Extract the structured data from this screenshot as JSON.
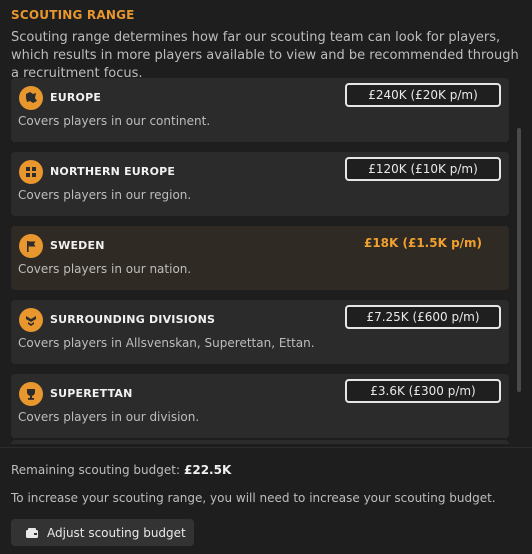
{
  "header": {
    "title": "SCOUTING RANGE",
    "description": "Scouting range determines how far our scouting team can look for players, which results in more players available to view and be recommended through a recruitment focus."
  },
  "ranges": [
    {
      "icon": "continent-icon",
      "name": "EUROPE",
      "coverage": "Covers players in our continent.",
      "price": "£240K (£20K p/m)",
      "selected": false
    },
    {
      "icon": "region-icon",
      "name": "NORTHERN EUROPE",
      "coverage": "Covers players in our region.",
      "price": "£120K (£10K p/m)",
      "selected": false
    },
    {
      "icon": "nation-flag-icon",
      "name": "SWEDEN",
      "coverage": "Covers players in our nation.",
      "price": "£18K (£1.5K p/m)",
      "selected": true
    },
    {
      "icon": "divisions-icon",
      "name": "SURROUNDING DIVISIONS",
      "coverage": "Covers players in Allsvenskan, Superettan, Ettan.",
      "price": "£7.25K (£600 p/m)",
      "selected": false
    },
    {
      "icon": "trophy-icon",
      "name": "SUPERETTAN",
      "coverage": "Covers players in our division.",
      "price": "£3.6K (£300 p/m)",
      "selected": false
    }
  ],
  "footer": {
    "budget_label": "Remaining scouting budget:",
    "budget_value": "£22.5K",
    "note": "To increase your scouting range, you will need to increase your scouting budget.",
    "adjust_label": "Adjust scouting budget"
  },
  "colors": {
    "accent": "#e8962e",
    "background": "#1e1e1e",
    "card": "#2b2b2b"
  }
}
